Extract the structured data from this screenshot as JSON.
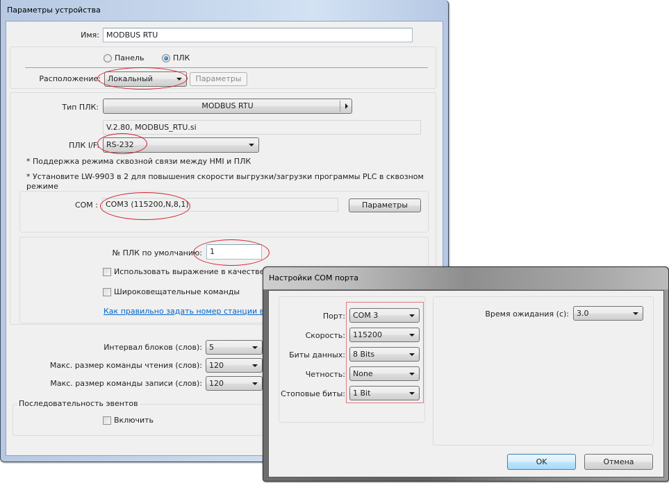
{
  "main_dialog": {
    "title": "Параметры устройства",
    "name_label": "Имя:",
    "name_value": "MODBUS RTU",
    "device_type": {
      "options": [
        {
          "label": "Панель",
          "selected": false
        },
        {
          "label": "ПЛК",
          "selected": true
        }
      ]
    },
    "location_label": "Расположение:",
    "location_value": "Локальный",
    "location_params_button": "Параметры",
    "plc_type_label": "Тип ПЛК:",
    "plc_type_value": "MODBUS RTU",
    "driver_info": "V.2.80, MODBUS_RTU.si",
    "plc_if_label": "ПЛК I/F:",
    "plc_if_value": "RS-232",
    "note_passthrough": "* Поддержка режима сквозной связи между HMI и ПЛК",
    "note_lw9903_line1": "* Установите LW-9903 в 2 для повышения скорости выгрузки/загрузки программы PLC в сквозном",
    "note_lw9903_line2": "режиме",
    "com_label": "COM :",
    "com_value": "COM3 (115200,N,8,1)",
    "com_params_button": "Параметры",
    "default_plc_no_label": "№ ПЛК по умолчанию:",
    "default_plc_no_value": "1",
    "use_expression_label": "Использовать выражение в качестве",
    "use_expression_checked": false,
    "broadcast_label": "Широковещательные команды",
    "broadcast_checked": false,
    "station_help_link": "Как правильно задать номер станции в адре",
    "block_interval_label": "Интервал блоков (слов):",
    "block_interval_value": "5",
    "max_read_label": "Макс. размер команды чтения (слов):",
    "max_read_value": "120",
    "max_write_label": "Макс. размер команды записи (слов):",
    "max_write_value": "120",
    "event_sequence_group": "Последовательность эвентов",
    "enable_label": "Включить",
    "enable_checked": false
  },
  "com_dialog": {
    "title": "Настройки COM порта",
    "port_label": "Порт:",
    "port_value": "COM 3",
    "speed_label": "Скорость:",
    "speed_value": "115200",
    "data_bits_label": "Биты данных:",
    "data_bits_value": "8 Bits",
    "parity_label": "Четность:",
    "parity_value": "None",
    "stop_bits_label": "Стоповые биты:",
    "stop_bits_value": "1 Bit",
    "timeout_label": "Время ожидания (с):",
    "timeout_value": "3.0",
    "ok_button": "OK",
    "cancel_button": "Отмена"
  },
  "colors": {
    "annotation_ellipse": "#d31f2a",
    "annotation_rect": "#e07a80",
    "link": "#0066cc"
  }
}
